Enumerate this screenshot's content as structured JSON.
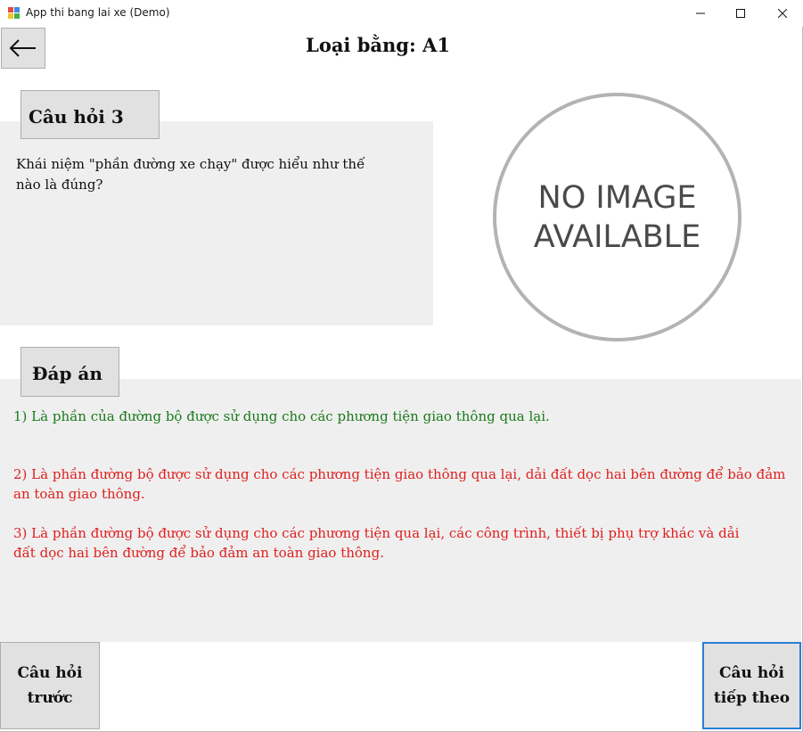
{
  "window": {
    "title": "App thi bang lai xe (Demo)",
    "icon": "app-window-icon",
    "controls": {
      "minimize_icon": "minimize-icon",
      "maximize_icon": "maximize-icon",
      "close_icon": "close-icon"
    }
  },
  "header": {
    "back_icon": "arrow-left-icon",
    "title": "Loại bằng: A1"
  },
  "question": {
    "label": "Câu hỏi 3",
    "text": "Khái niệm \"phần đường xe chạy\" được hiểu như thế nào là đúng?"
  },
  "image_placeholder": {
    "line1": "NO IMAGE",
    "line2": "AVAILABLE"
  },
  "answers": {
    "label": "Đáp án",
    "items": [
      {
        "text": "1) Là phần của đường bộ được sử dụng cho các phương tiện giao thông qua lại.",
        "color": "#1a7a1a"
      },
      {
        "text": "2) Là phần đường bộ được sử dụng cho các phương tiện giao thông qua lại, dải đất dọc hai bên đường để bảo đảm an toàn giao thông.",
        "color": "#e01f1f"
      },
      {
        "text": "3) Là phần đường bộ được sử dụng cho các phương tiện qua lại, các công trình, thiết bị phụ trợ khác và dải đất dọc hai bên đường để bảo đảm an toàn giao thông.",
        "color": "#e01f1f"
      }
    ]
  },
  "navigation": {
    "prev_label": "Câu hỏi trước",
    "next_label": "Câu hỏi tiếp theo"
  },
  "colors": {
    "panel_bg": "#efefef",
    "button_bg": "#e1e1e1",
    "focus_border": "#2a7fd4",
    "correct": "#1a7a1a",
    "incorrect": "#e01f1f"
  }
}
